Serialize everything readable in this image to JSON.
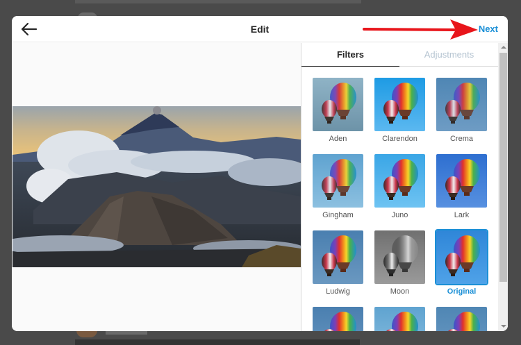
{
  "header": {
    "title": "Edit",
    "next_label": "Next"
  },
  "tabs": [
    {
      "label": "Filters",
      "active": true
    },
    {
      "label": "Adjustments",
      "active": false
    }
  ],
  "filters": [
    {
      "label": "Aden"
    },
    {
      "label": "Clarendon"
    },
    {
      "label": "Crema"
    },
    {
      "label": "Gingham"
    },
    {
      "label": "Juno"
    },
    {
      "label": "Lark"
    },
    {
      "label": "Ludwig"
    },
    {
      "label": "Moon"
    },
    {
      "label": "Original",
      "selected": true
    },
    {
      "label": ""
    },
    {
      "label": ""
    },
    {
      "label": ""
    }
  ],
  "colors": {
    "accent": "#1a8fd6",
    "annotation_arrow": "#e8151b",
    "overlay": "#4a4a4a"
  }
}
